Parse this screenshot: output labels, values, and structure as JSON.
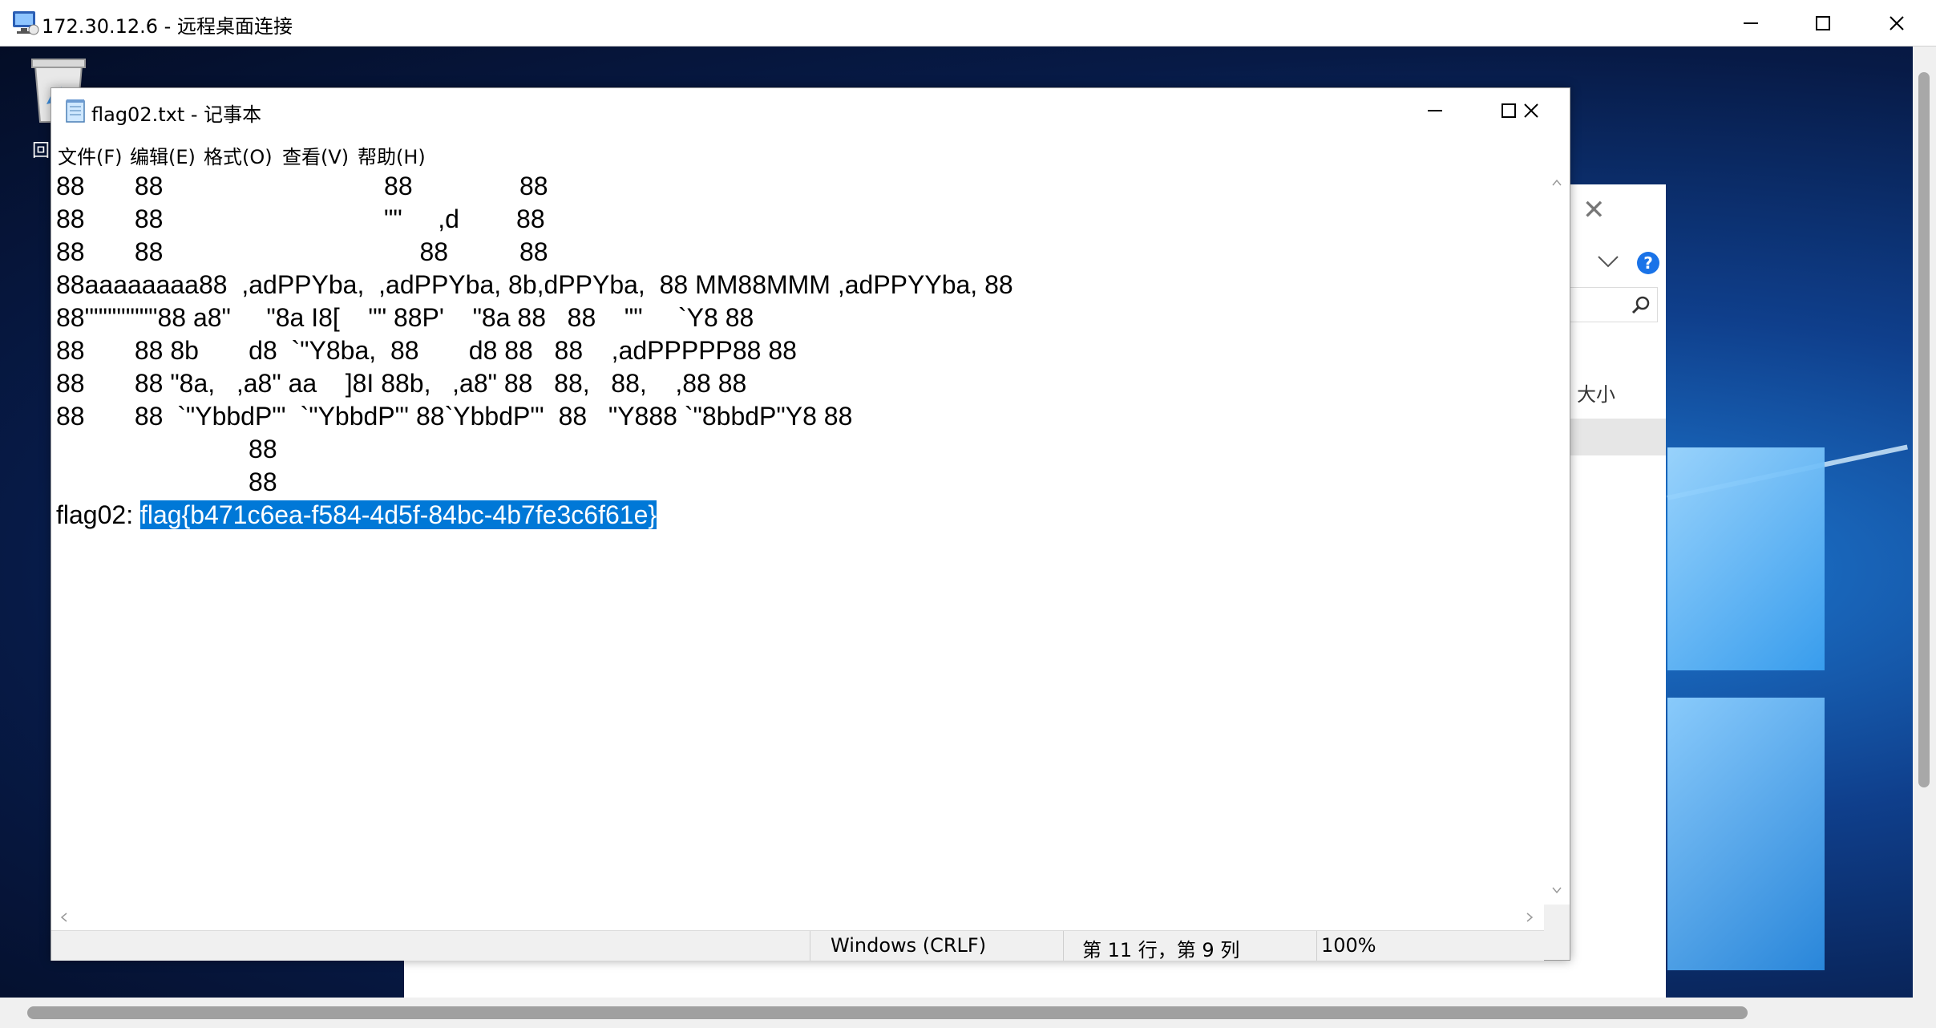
{
  "rdp": {
    "title": "172.30.12.6 - 远程桌面连接"
  },
  "desktop": {
    "recycle_label": "回"
  },
  "explorer": {
    "column_label": "大小",
    "help_label": "?"
  },
  "notepad": {
    "title": "flag02.txt - 记事本",
    "menu": [
      "文件(F)",
      "编辑(E)",
      "格式(O)",
      "查看(V)",
      "帮助(H)"
    ],
    "lines": [
      "88       88                               88               88",
      "88       88                               \"\"     ,d        88",
      "88       88                                    88          88",
      "88aaaaaaaa88  ,adPPYba,  ,adPPYba, 8b,dPPYba,  88 MM88MMM ,adPPYYba, 88",
      "88\"\"\"\"\"\"\"\"88 a8\"     \"8a I8[    \"\" 88P'    \"8a 88   88    \"\"     `Y8 88",
      "88       88 8b       d8  `\"Y8ba,  88       d8 88   88    ,adPPPPP88 88",
      "88       88 \"8a,   ,a8\" aa    ]8I 88b,   ,a8\" 88   88,   88,    ,88 88",
      "88       88  `\"YbbdP\"'  `\"YbbdP\"' 88`YbbdP\"'  88   \"Y888 `\"8bbdP\"Y8 88",
      "                           88",
      "                           88"
    ],
    "flag_prefix": "flag02: ",
    "flag_value": "flag{b471c6ea-f584-4d5f-84bc-4b7fe3c6f61e}",
    "status": {
      "encoding": "Windows (CRLF)",
      "position": "第 11 行，第 9 列",
      "zoom": "100%"
    }
  },
  "colors": {
    "selection": "#0078d7",
    "help_accent": "#1a73e8"
  }
}
